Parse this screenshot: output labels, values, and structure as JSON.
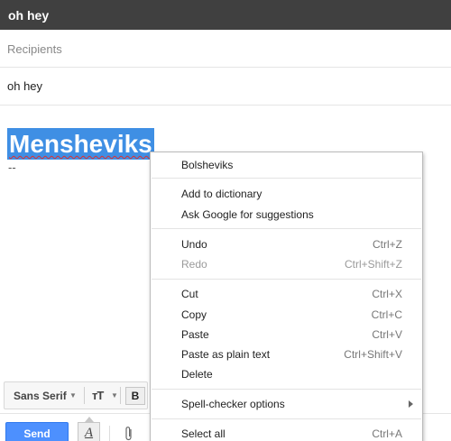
{
  "window": {
    "title": "oh hey"
  },
  "compose": {
    "recipients_placeholder": "Recipients",
    "subject": "oh hey",
    "body": {
      "selected_word": "Mensheviks",
      "signature": "--"
    }
  },
  "format_bar": {
    "font": "Sans Serif",
    "size_label": "тT",
    "bold_label": "B"
  },
  "bottom": {
    "send_label": "Send",
    "formatting_label": "A"
  },
  "context_menu": {
    "suggestion": "Bolsheviks",
    "add_to_dictionary": "Add to dictionary",
    "ask_google": "Ask Google for suggestions",
    "undo": {
      "label": "Undo",
      "shortcut": "Ctrl+Z"
    },
    "redo": {
      "label": "Redo",
      "shortcut": "Ctrl+Shift+Z"
    },
    "cut": {
      "label": "Cut",
      "shortcut": "Ctrl+X"
    },
    "copy": {
      "label": "Copy",
      "shortcut": "Ctrl+C"
    },
    "paste": {
      "label": "Paste",
      "shortcut": "Ctrl+V"
    },
    "paste_plain": {
      "label": "Paste as plain text",
      "shortcut": "Ctrl+Shift+V"
    },
    "delete": {
      "label": "Delete"
    },
    "spell_checker": {
      "label": "Spell-checker options"
    },
    "select_all": {
      "label": "Select all",
      "shortcut": "Ctrl+A"
    }
  },
  "colors": {
    "titlebar": "#404040",
    "selection": "#3f8fe4",
    "send_button": "#4d90fe"
  }
}
